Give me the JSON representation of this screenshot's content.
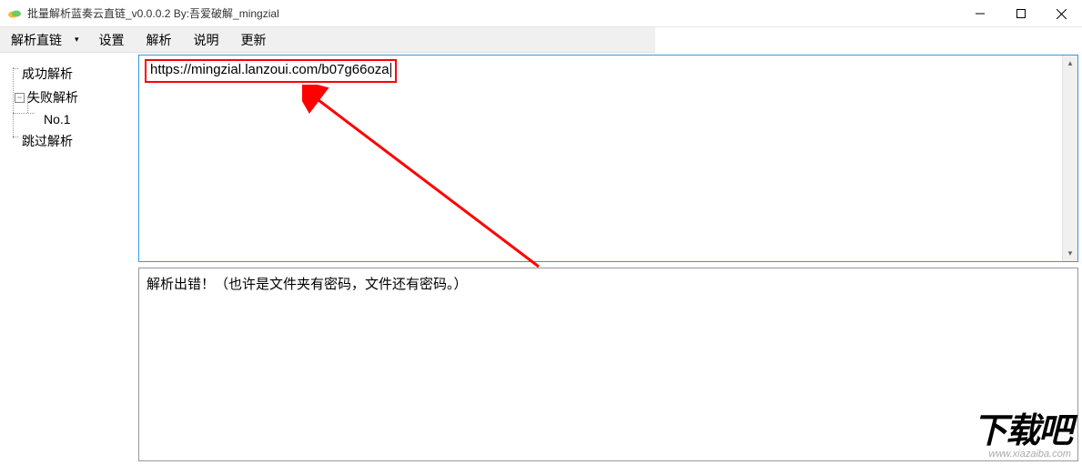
{
  "titlebar": {
    "title": "批量解析蓝奏云直链_v0.0.0.2 By:吾爱破解_mingzial"
  },
  "menu": {
    "items": [
      "解析直链",
      "设置",
      "解析",
      "说明",
      "更新"
    ]
  },
  "sidebar": {
    "items": [
      {
        "label": "成功解析",
        "level": 0,
        "expandable": false
      },
      {
        "label": "失败解析",
        "level": 1,
        "expandable": true,
        "expanded": true
      },
      {
        "label": "No.1",
        "level": 2,
        "expandable": false
      },
      {
        "label": "跳过解析",
        "level": 0,
        "expandable": false
      }
    ]
  },
  "url_input": {
    "value": "https://mingzial.lanzoui.com/b07g66oza"
  },
  "output": {
    "message": "解析出错！（也许是文件夹有密码，文件还有密码。）"
  },
  "watermark": {
    "main": "下载吧",
    "url": "www.xiazaiba.com"
  }
}
